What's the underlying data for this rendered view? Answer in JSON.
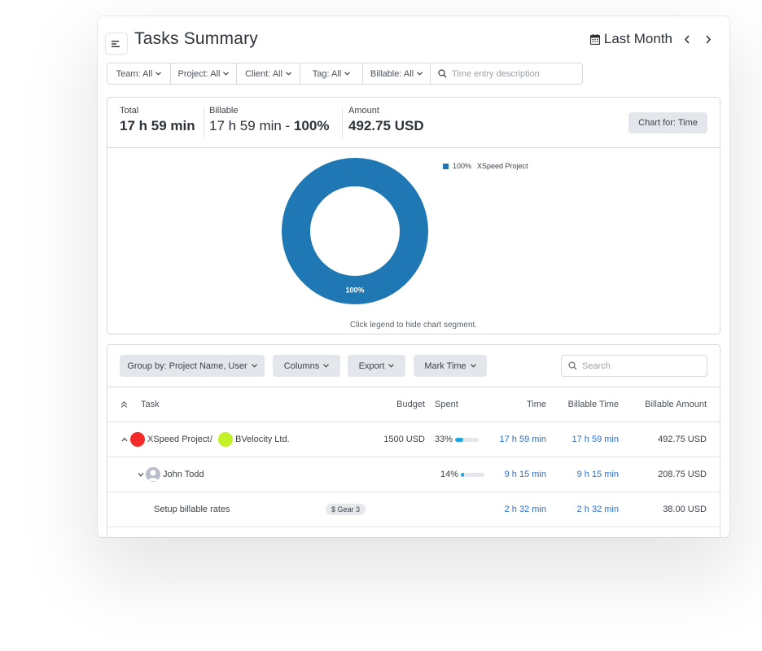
{
  "header": {
    "title": "Tasks Summary",
    "date_range": "Last Month",
    "menu_icon": "menu-icon",
    "calendar_icon": "calendar-icon",
    "prev_icon": "chevron-left-icon",
    "next_icon": "chevron-right-icon"
  },
  "filters": {
    "items": [
      {
        "label": "Team: All"
      },
      {
        "label": "Project: All"
      },
      {
        "label": "Client: All"
      },
      {
        "label": "Tag: All"
      },
      {
        "label": "Billable: All"
      }
    ],
    "search_placeholder": "Time entry description",
    "search_value": ""
  },
  "summary": {
    "total_label": "Total",
    "total_value": "17 h 59 min",
    "billable_label": "Billable",
    "billable_value": "17 h 59 min - ",
    "billable_pct": "100%",
    "amount_label": "Amount",
    "amount_value": "492.75 USD",
    "chart_for_label": "Chart for: Time",
    "chart_hint": "Click legend to hide chart segment."
  },
  "chart_data": {
    "type": "pie",
    "variant": "donut",
    "title": "",
    "slices": [
      {
        "label": "XSpeed Project",
        "value": 100,
        "percent_label": "100%",
        "color": "#1f77b4"
      }
    ],
    "legend_position": "top-right"
  },
  "table": {
    "toolbar": {
      "group_by_label": "Group by: Project Name, User",
      "columns_label": "Columns",
      "export_label": "Export",
      "mark_time_label": "Mark Time",
      "search_placeholder": "Search",
      "search_value": ""
    },
    "columns": {
      "task": "Task",
      "budget": "Budget",
      "spent": "Spent",
      "time": "Time",
      "billable_time": "Billable Time",
      "billable_amount": "Billable Amount"
    },
    "project_row": {
      "project": "XSpeed Project",
      "project_color": "#f52a2a",
      "separator": "/",
      "client": "BVelocity Ltd.",
      "client_color": "#c3f22a",
      "budget": "1500 USD",
      "spent_pct_label": "33%",
      "spent_fraction": 0.33,
      "time": "17 h 59 min",
      "billable_time": "17 h 59 min",
      "billable_amount": "492.75 USD"
    },
    "user_row": {
      "user": "John Todd",
      "spent_pct_label": "14%",
      "spent_fraction": 0.14,
      "time": "9 h 15 min",
      "billable_time": "9 h 15 min",
      "billable_amount": "208.75 USD"
    },
    "task_rows": [
      {
        "task": "Setup billable rates",
        "tag": "$ Gear 3",
        "time": "2 h 32 min",
        "billable_time": "2 h 32 min",
        "billable_amount": "38.00 USD"
      }
    ]
  }
}
